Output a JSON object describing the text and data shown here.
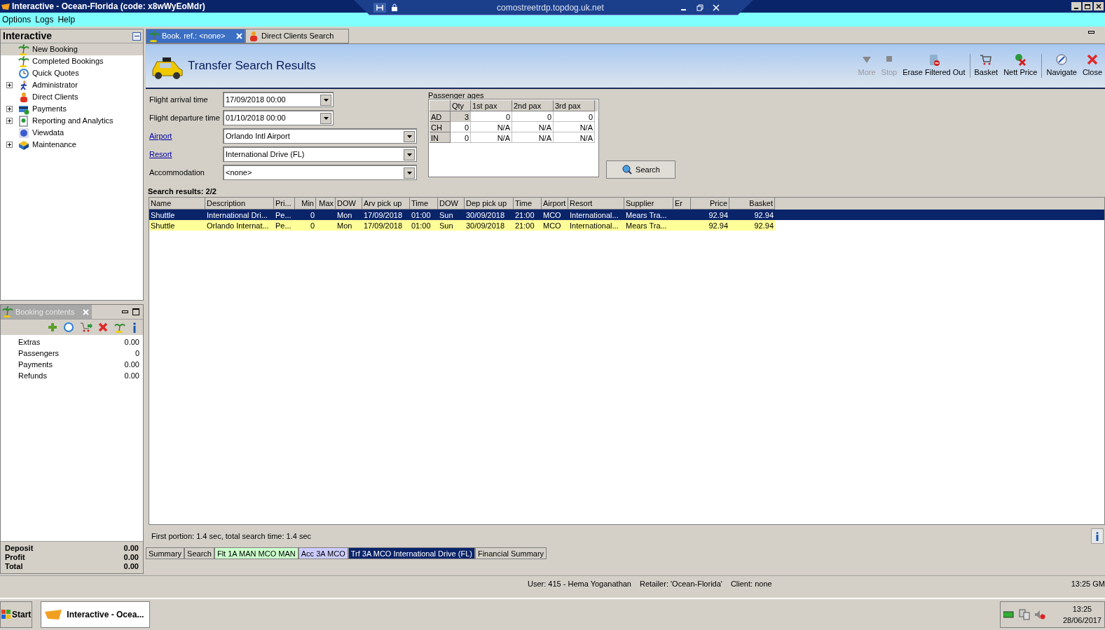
{
  "window": {
    "title": "Interactive - Ocean-Florida (code: x8wWyEoMdr)"
  },
  "remote_bar": {
    "host": "comostreetrdp.topdog.uk.net"
  },
  "menu": [
    "Options",
    "Logs",
    "Help"
  ],
  "sidebar": {
    "title": "Interactive",
    "items": [
      {
        "label": "New Booking",
        "expandable": false,
        "selected": true
      },
      {
        "label": "Completed Bookings",
        "expandable": false,
        "selected": false
      },
      {
        "label": "Quick Quotes",
        "expandable": false,
        "selected": false
      },
      {
        "label": "Administrator",
        "expandable": true,
        "selected": false
      },
      {
        "label": "Direct Clients",
        "expandable": false,
        "selected": false
      },
      {
        "label": "Payments",
        "expandable": true,
        "selected": false
      },
      {
        "label": "Reporting and Analytics",
        "expandable": true,
        "selected": false
      },
      {
        "label": "Viewdata",
        "expandable": false,
        "selected": false
      },
      {
        "label": "Maintenance",
        "expandable": true,
        "selected": false
      }
    ]
  },
  "booking_contents": {
    "title": "Booking contents",
    "lines": [
      {
        "label": "Extras",
        "value": "0.00"
      },
      {
        "label": "Passengers",
        "value": "0"
      },
      {
        "label": "Payments",
        "value": "0.00"
      },
      {
        "label": "Refunds",
        "value": "0.00"
      }
    ],
    "totals": [
      {
        "label": "Deposit",
        "value": "0.00"
      },
      {
        "label": "Profit",
        "value": "0.00"
      },
      {
        "label": "Total",
        "value": "0.00"
      }
    ]
  },
  "tabs": [
    {
      "label": "Book. ref.: <none>",
      "selected": true,
      "closable": true
    },
    {
      "label": "Direct Clients Search",
      "selected": false,
      "closable": false
    }
  ],
  "page_title": "Transfer Search Results",
  "toolbar": [
    {
      "label": "More",
      "disabled": true,
      "separator_after": false
    },
    {
      "label": "Stop",
      "disabled": true,
      "separator_after": false
    },
    {
      "label": "Erase Filtered Out",
      "disabled": false,
      "separator_after": true
    },
    {
      "label": "Basket",
      "disabled": false,
      "separator_after": false
    },
    {
      "label": "Nett Price",
      "disabled": false,
      "separator_after": true
    },
    {
      "label": "Navigate",
      "disabled": false,
      "separator_after": false
    },
    {
      "label": "Close",
      "disabled": false,
      "separator_after": false
    }
  ],
  "form": [
    {
      "label": "Flight arrival time",
      "link": false,
      "value": "17/09/2018 00:00",
      "kind": "date"
    },
    {
      "label": "Flight departure time",
      "link": false,
      "value": "01/10/2018 00:00",
      "kind": "date"
    },
    {
      "label": "Airport",
      "link": true,
      "value": "Orlando Intl Airport",
      "kind": "select"
    },
    {
      "label": "Resort",
      "link": true,
      "value": "International Drive (FL)",
      "kind": "select"
    },
    {
      "label": "Accommodation",
      "link": false,
      "value": "<none>",
      "kind": "select"
    }
  ],
  "passenger_ages": {
    "title": "Passenger ages",
    "columns": [
      "Qty",
      "1st pax",
      "2nd pax",
      "3rd pax"
    ],
    "rows": [
      {
        "label": "AD",
        "cells": [
          "3",
          "0",
          "0",
          "0"
        ]
      },
      {
        "label": "CH",
        "cells": [
          "0",
          "N/A",
          "N/A",
          "N/A"
        ]
      },
      {
        "label": "IN",
        "cells": [
          "0",
          "N/A",
          "N/A",
          "N/A"
        ]
      }
    ]
  },
  "search_button": "Search",
  "results": {
    "title": "Search results: 2/2",
    "columns": [
      "Name",
      "Description",
      "Pri...",
      "Min",
      "Max",
      "DOW",
      "Arv pick up",
      "Time",
      "DOW",
      "Dep pick up",
      "Time",
      "Airport",
      "Resort",
      "Supplier",
      "Er",
      "Price",
      "Basket"
    ],
    "rows": [
      {
        "selected": true,
        "cells": [
          "Shuttle",
          "International Dri...",
          "Pe...",
          "0",
          null,
          "Mon",
          "17/09/2018",
          "01:00",
          "Sun",
          "30/09/2018",
          "21:00",
          "MCO",
          "International...",
          "Mears Tra...",
          null,
          "92.94",
          "92.94"
        ]
      },
      {
        "selected": false,
        "cells": [
          "Shuttle",
          "Orlando Internat...",
          "Pe...",
          "0",
          null,
          "Mon",
          "17/09/2018",
          "01:00",
          "Sun",
          "30/09/2018",
          "21:00",
          "MCO",
          "International...",
          "Mears Tra...",
          null,
          "92.94",
          "92.94"
        ]
      }
    ]
  },
  "timing": "First portion: 1.4 sec, total search time: 1.4 sec",
  "bottom_tabs": [
    {
      "label": "Summary",
      "selected": false
    },
    {
      "label": "Search",
      "selected": false
    },
    {
      "label": "Flt 1A MAN MCO MAN",
      "selected": false,
      "color": "#ccffcc"
    },
    {
      "label": "Acc 3A MCO",
      "selected": false,
      "color": "#ccccff"
    },
    {
      "label": "Trf 3A MCO International Drive (FL)",
      "selected": true
    },
    {
      "label": "Financial Summary",
      "selected": false
    }
  ],
  "status_bar": [
    "User: 415 - Hema Yoganathan",
    "Retailer: 'Ocean-Florida'",
    "Client: none",
    "13:25 GM"
  ],
  "taskbar": {
    "start": "Start",
    "task": "Interactive - Ocea...",
    "time": "13:25",
    "date": "28/06/2017"
  }
}
